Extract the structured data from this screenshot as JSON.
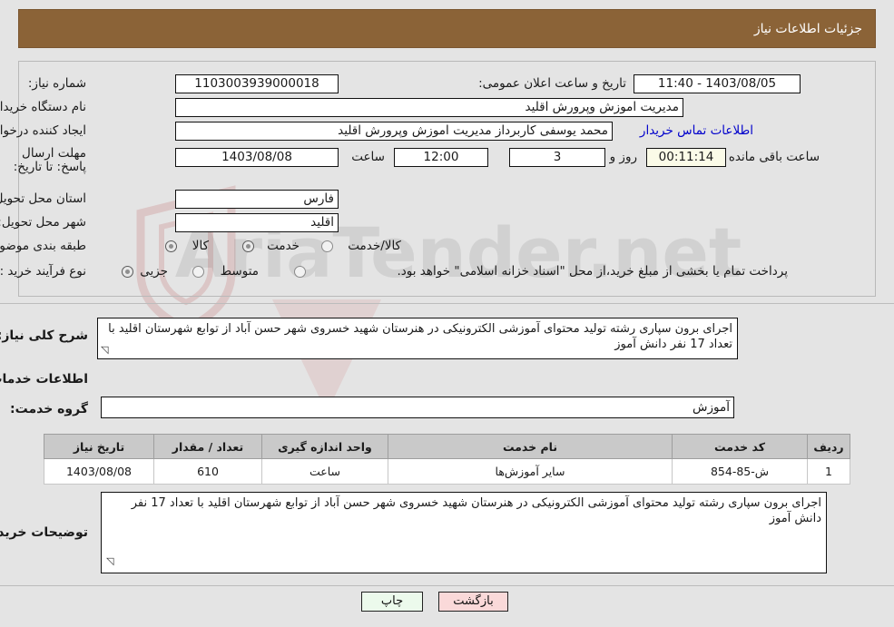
{
  "header": {
    "title": "جزئیات اطلاعات نیاز"
  },
  "form": {
    "need_number_label": "شماره نیاز:",
    "need_number_value": "1103003939000018",
    "announce_datetime_label": "تاریخ و ساعت اعلان عمومی:",
    "announce_datetime_value": "1403/08/05 - 11:40",
    "buyer_org_label": "نام دستگاه خریدار:",
    "buyer_org_value": "مدیریت اموزش وپرورش اقلید",
    "request_creator_label": "ایجاد کننده درخواست:",
    "request_creator_value": "محمد یوسفی کاربرداز مدیریت اموزش وپرورش اقلید",
    "buyer_contact_link": "اطلاعات تماس خریدار",
    "deadline_label": "مهلت ارسال پاسخ: تا تاریخ:",
    "deadline_date": "1403/08/08",
    "deadline_hour_label": "ساعت",
    "deadline_hour_value": "12:00",
    "days_value": "3",
    "days_label": "روز و",
    "countdown_value": "00:11:14",
    "countdown_label": "ساعت باقی مانده",
    "province_label": "استان محل تحویل:",
    "province_value": "فارس",
    "city_label": "شهر محل تحویل:",
    "city_value": "اقلید",
    "category_label": "طبقه بندی موضوعی:",
    "category_options": [
      "کالا",
      "خدمت",
      "کالا/خدمت"
    ],
    "category_selected": "خدمت",
    "process_type_label": "نوع فرآیند خرید :",
    "process_type_options": [
      "جزیی",
      "متوسط"
    ],
    "process_type_selected": "جزیی",
    "treasury_note": "پرداخت تمام یا بخشی از مبلغ خرید،از محل \"اسناد خزانه اسلامی\" خواهد بود."
  },
  "summary": {
    "label": "شرح کلی نیاز:",
    "value": "اجرای برون سپاری رشته تولید محتوای آموزشی الکترونیکی در هنرستان شهید خسروی شهر حسن آباد از توابع شهرستان اقلید با تعداد 17 نفر دانش آموز"
  },
  "services_section": {
    "heading": "اطلاعات خدمات مورد نیاز",
    "group_label": "گروه خدمت:",
    "group_value": "آموزش"
  },
  "table": {
    "columns": [
      "ردیف",
      "کد خدمت",
      "نام خدمت",
      "واحد اندازه گیری",
      "تعداد / مقدار",
      "تاریخ نیاز"
    ],
    "rows": [
      {
        "row_no": "1",
        "service_code": "ش-85-854",
        "service_name": "سایر آموزش‌ها",
        "unit": "ساعت",
        "quantity": "610",
        "need_date": "1403/08/08"
      }
    ]
  },
  "buyer_notes": {
    "label": "توضیحات خریدار:",
    "value": "اجرای برون سپاری رشته تولید محتوای آموزشی الکترونیکی در هنرستان شهید خسروی شهر حسن آباد از توابع شهرستان اقلید با تعداد 17 نفر دانش آموز"
  },
  "footer": {
    "print_button": "چاپ",
    "back_button": "بازگشت"
  },
  "watermark": {
    "text": "AriaTender.net"
  },
  "colors": {
    "header_bg": "#8b6337",
    "page_bg": "#e4e4e4",
    "link": "#0000cc",
    "table_header_bg": "#c9c9c9",
    "print_btn_bg": "#ecfaec",
    "back_btn_bg": "#fad9d9"
  }
}
